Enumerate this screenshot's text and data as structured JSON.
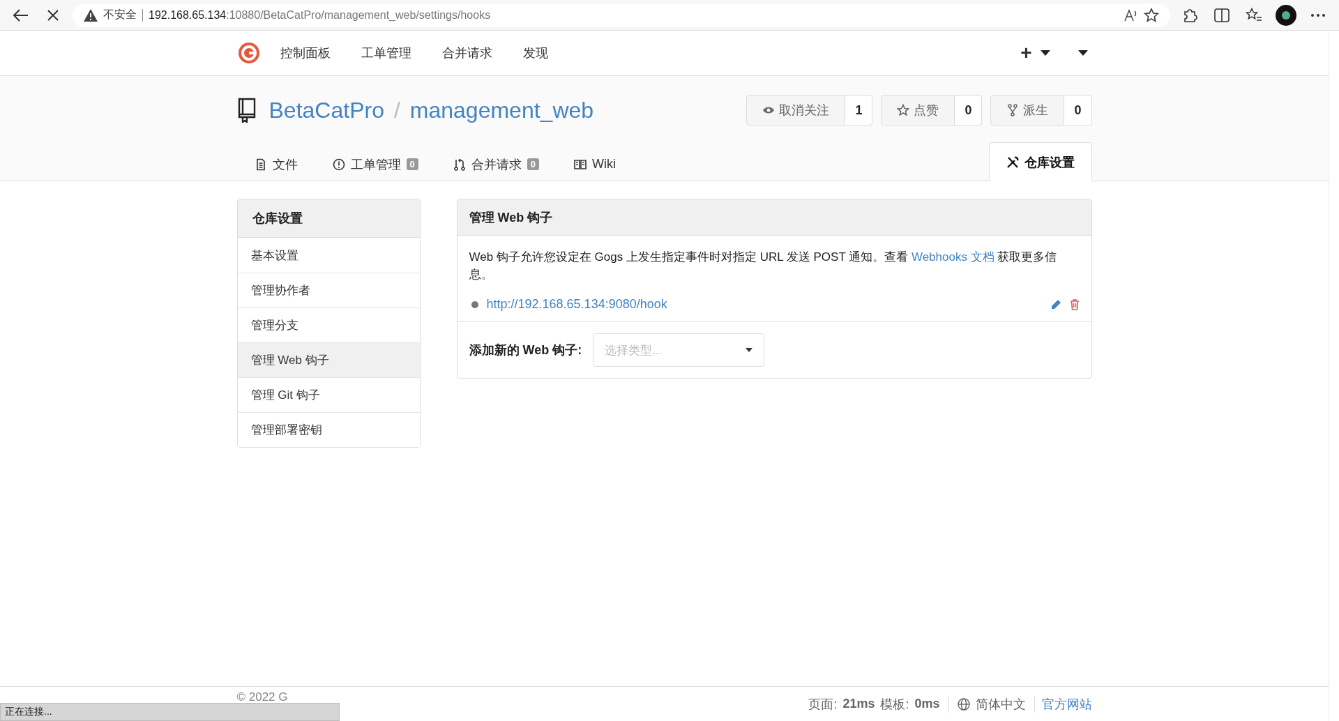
{
  "browser": {
    "security_label": "不安全",
    "url_host": "192.168.65.134",
    "url_rest": ":10880/BetaCatPro/management_web/settings/hooks"
  },
  "nav": {
    "items": [
      "控制面板",
      "工单管理",
      "合并请求",
      "发现"
    ],
    "plus": "+"
  },
  "repo": {
    "owner": "BetaCatPro",
    "separator": "/",
    "name": "management_web",
    "buttons": [
      {
        "kind": "eye",
        "label": "取消关注",
        "count": "1"
      },
      {
        "kind": "star",
        "label": "点赞",
        "count": "0"
      },
      {
        "kind": "fork",
        "label": "派生",
        "count": "0"
      }
    ]
  },
  "tabs": [
    {
      "kind": "file",
      "label": "文件",
      "selected": false
    },
    {
      "kind": "issue",
      "label": "工单管理",
      "badge": "0",
      "selected": false
    },
    {
      "kind": "pr",
      "label": "合并请求",
      "badge": "0",
      "selected": false
    },
    {
      "kind": "wiki",
      "label": "Wiki",
      "selected": false
    },
    {
      "kind": "settings",
      "label": "仓库设置",
      "selected": true
    }
  ],
  "sidebar": {
    "title": "仓库设置",
    "items": [
      {
        "label": "基本设置",
        "selected": false
      },
      {
        "label": "管理协作者",
        "selected": false
      },
      {
        "label": "管理分支",
        "selected": false
      },
      {
        "label": "管理 Web 钩子",
        "selected": true
      },
      {
        "label": "管理 Git 钩子",
        "selected": false
      },
      {
        "label": "管理部署密钥",
        "selected": false
      }
    ]
  },
  "panel": {
    "title": "管理 Web 钩子",
    "description_before": "Web 钩子允许您设定在 Gogs 上发生指定事件时对指定 URL 发送 POST 通知。查看 ",
    "description_link": "Webhooks 文档",
    "description_after": " 获取更多信息。",
    "webhooks": [
      {
        "url": "http://192.168.65.134:9080/hook"
      }
    ],
    "add_label": "添加新的 Web 钩子:",
    "select_placeholder": "选择类型..."
  },
  "footer": {
    "copyright": "© 2022 G",
    "timing": "页面: **21ms** 模板: **0ms**",
    "language": "简体中文",
    "website": "官方网站"
  },
  "status_bubble": "正在连接..."
}
